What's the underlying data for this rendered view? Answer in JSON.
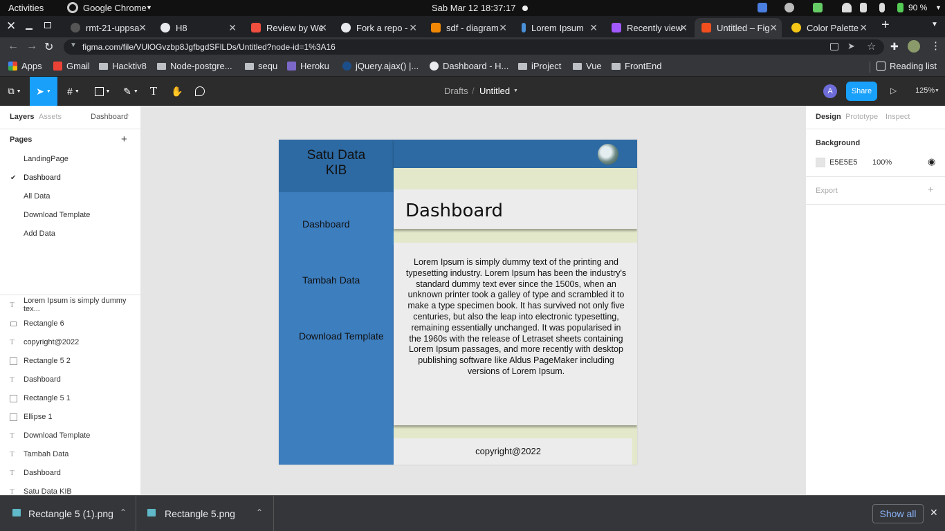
{
  "system_bar": {
    "activities": "Activities",
    "app": "Google Chrome",
    "clock": "Sab Mar 12  18:37:17",
    "battery": "90 %"
  },
  "tabs": [
    {
      "title": "rmt-21-uppsa",
      "color": "#e8eaed"
    },
    {
      "title": "H8",
      "color": "#e8eaed"
    },
    {
      "title": "Review by We",
      "color": "#f04e3e"
    },
    {
      "title": "Fork a repo -",
      "color": "#e8eaed"
    },
    {
      "title": "sdf - diagram",
      "color": "#f08705"
    },
    {
      "title": "Lorem Ipsum",
      "color": "#4a90d9"
    },
    {
      "title": "Recently view",
      "color": "#a259ff"
    },
    {
      "title": "Untitled – Fig",
      "color": "#f24e1e"
    },
    {
      "title": "Color Palette",
      "color": "#f5c518"
    }
  ],
  "address": {
    "url": "figma.com/file/VUlOGvzbp8JgfbgdSFlLDs/Untitled?node-id=1%3A16"
  },
  "bookmarks": [
    {
      "label": "Apps",
      "type": "apps"
    },
    {
      "label": "Gmail",
      "type": "gmail"
    },
    {
      "label": "Hacktiv8",
      "type": "folder"
    },
    {
      "label": "Node-postgre...",
      "type": "folder"
    },
    {
      "label": "sequ",
      "type": "folder"
    },
    {
      "label": "Heroku",
      "type": "heroku"
    },
    {
      "label": "jQuery.ajax() |...",
      "type": "jquery"
    },
    {
      "label": "Dashboard - H...",
      "type": "globe"
    },
    {
      "label": "iProject",
      "type": "folder"
    },
    {
      "label": "Vue",
      "type": "folder"
    },
    {
      "label": "FrontEnd",
      "type": "folder"
    }
  ],
  "reading_list": "Reading list",
  "figma": {
    "breadcrumb_root": "Drafts",
    "breadcrumb_sep": "/",
    "file_name": "Untitled",
    "avatar_letter": "A",
    "share_label": "Share",
    "zoom": "125%",
    "accent": "#18a0fb"
  },
  "left_panel": {
    "tab_layers": "Layers",
    "tab_assets": "Assets",
    "page_dropdown": "Dashboard",
    "pages_heading": "Pages",
    "add_icon": "+",
    "pages": [
      {
        "label": "LandingPage",
        "selected": false
      },
      {
        "label": "Dashboard",
        "selected": true
      },
      {
        "label": "All Data",
        "selected": false
      },
      {
        "label": "Download Template",
        "selected": false
      },
      {
        "label": "Add Data",
        "selected": false
      }
    ],
    "layers": [
      {
        "label": "Lorem Ipsum is simply dummy tex...",
        "icon": "text-icon"
      },
      {
        "label": "Rectangle 6",
        "icon": "rectangle-icon"
      },
      {
        "label": "copyright@2022",
        "icon": "text-icon"
      },
      {
        "label": "Rectangle 5 2",
        "icon": "image-icon"
      },
      {
        "label": "Dashboard",
        "icon": "text-icon"
      },
      {
        "label": "Rectangle 5 1",
        "icon": "image-icon"
      },
      {
        "label": "Ellipse 1",
        "icon": "image-icon"
      },
      {
        "label": "Download Template",
        "icon": "text-icon"
      },
      {
        "label": "Tambah Data",
        "icon": "text-icon"
      },
      {
        "label": "Dashboard",
        "icon": "text-icon"
      },
      {
        "label": "Satu Data KIB",
        "icon": "text-icon"
      }
    ]
  },
  "right_panel": {
    "tabs": [
      "Design",
      "Prototype",
      "Inspect"
    ],
    "background_heading": "Background",
    "bg_hex": "E5E5E5",
    "bg_opacity": "100%",
    "export_heading": "Export",
    "export_add": "+"
  },
  "frame": {
    "logo_line1": "Satu Data",
    "logo_line2": "KIB",
    "nav": [
      "Dashboard",
      "Tambah Data",
      "Download Template"
    ],
    "page_title": "Dashboard",
    "body": "Lorem Ipsum is simply dummy text of the printing and typesetting industry. Lorem Ipsum has been the industry's standard dummy text ever since the 1500s, when an unknown printer took a galley of type and scrambled it to make a type specimen book. It has survived not only five centuries, but also the leap into electronic typesetting, remaining essentially unchanged. It was popularised in the 1960s with the release of Letraset sheets containing Lorem Ipsum passages, and more recently with desktop publishing software like Aldus PageMaker including versions of Lorem Ipsum.",
    "footer": "copyright@2022",
    "colors": {
      "sidebar": "#3d7ebf",
      "header": "#2d6aa3",
      "strip": "#e2e8c9",
      "card": "#ececec"
    }
  },
  "help_label": "?",
  "downloads": [
    {
      "name": "Rectangle 5 (1).png"
    },
    {
      "name": "Rectangle 5.png"
    }
  ],
  "show_all": "Show all"
}
